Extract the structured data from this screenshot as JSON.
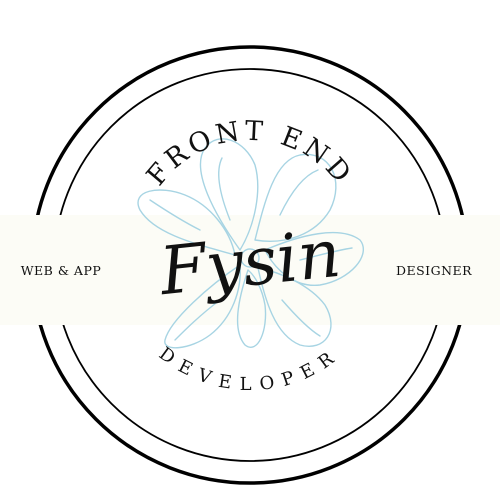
{
  "badge": {
    "top_arc_text": "FRONT END",
    "bottom_arc_text": "DEVELOPER",
    "left_band_text": "WEB & APP",
    "right_band_text": "DESIGNER",
    "logo_script_text": "Fysin",
    "flower_icon": "flower-icon"
  },
  "colors": {
    "ring": "#000000",
    "band": "#fcfcf6",
    "flower": "#a7d4e3",
    "text": "#111111"
  }
}
